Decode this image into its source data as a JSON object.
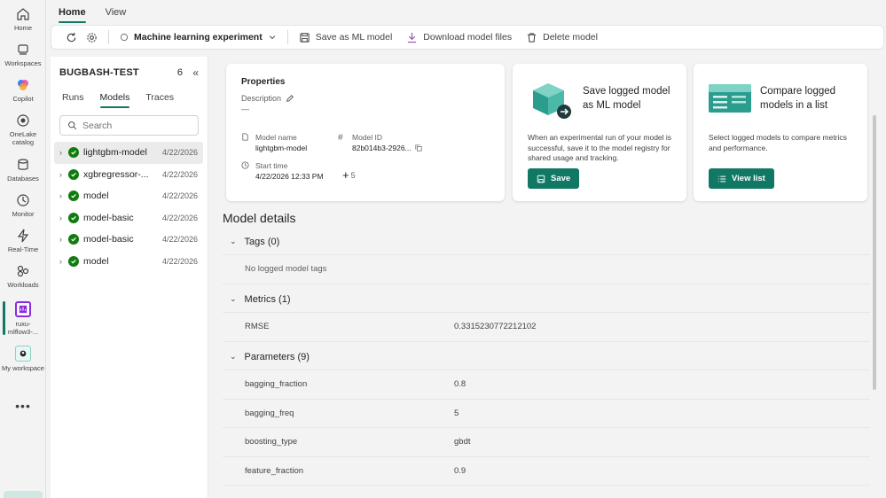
{
  "rail": {
    "items": [
      {
        "label": "Home"
      },
      {
        "label": "Workspaces"
      },
      {
        "label": "Copilot"
      },
      {
        "label": "OneLake catalog"
      },
      {
        "label": "Databases"
      },
      {
        "label": "Monitor"
      },
      {
        "label": "Real-Time"
      },
      {
        "label": "Workloads"
      },
      {
        "label": "ruxu-mlflow3-..."
      },
      {
        "label": "My workspace"
      }
    ],
    "more": "•••"
  },
  "top_tabs": [
    {
      "label": "Home",
      "active": true
    },
    {
      "label": "View",
      "active": false
    }
  ],
  "toolbar": {
    "experiment_label": "Machine learning experiment",
    "save_label": "Save as ML model",
    "download_label": "Download model files",
    "delete_label": "Delete model"
  },
  "left_panel": {
    "title": "BUGBASH-TEST",
    "count": "6",
    "tabs": [
      {
        "label": "Runs"
      },
      {
        "label": "Models"
      },
      {
        "label": "Traces"
      }
    ],
    "search_placeholder": "Search",
    "models": [
      {
        "name": "lightgbm-model",
        "date": "4/22/2026"
      },
      {
        "name": "xgbregressor-...",
        "date": "4/22/2026"
      },
      {
        "name": "model",
        "date": "4/22/2026"
      },
      {
        "name": "model-basic",
        "date": "4/22/2026"
      },
      {
        "name": "model-basic",
        "date": "4/22/2026"
      },
      {
        "name": "model",
        "date": "4/22/2026"
      }
    ]
  },
  "properties": {
    "title": "Properties",
    "description_label": "Description",
    "description_value": "—",
    "model_name_label": "Model name",
    "model_name_value": "lightgbm-model",
    "model_id_label": "Model ID",
    "model_id_value": "82b014b3-2926...",
    "start_time_label": "Start time",
    "start_time_value": "4/22/2026 12:33 PM",
    "more_count": "5"
  },
  "save_card": {
    "title": "Save logged model as ML model",
    "description": "When an experimental run of your model is successful, save it to the model registry for shared usage and tracking.",
    "button_label": "Save"
  },
  "compare_card": {
    "title": "Compare logged models in a list",
    "description": "Select logged models to compare metrics and performance.",
    "button_label": "View list"
  },
  "model_details": {
    "title": "Model details",
    "tags_header": "Tags (0)",
    "tags_empty": "No logged model tags",
    "metrics_header": "Metrics (1)",
    "metrics": [
      {
        "key": "RMSE",
        "value": "0.3315230772212102"
      }
    ],
    "params_header": "Parameters (9)",
    "params": [
      {
        "key": "bagging_fraction",
        "value": "0.8"
      },
      {
        "key": "bagging_freq",
        "value": "5"
      },
      {
        "key": "boosting_type",
        "value": "gbdt"
      },
      {
        "key": "feature_fraction",
        "value": "0.9"
      }
    ]
  }
}
